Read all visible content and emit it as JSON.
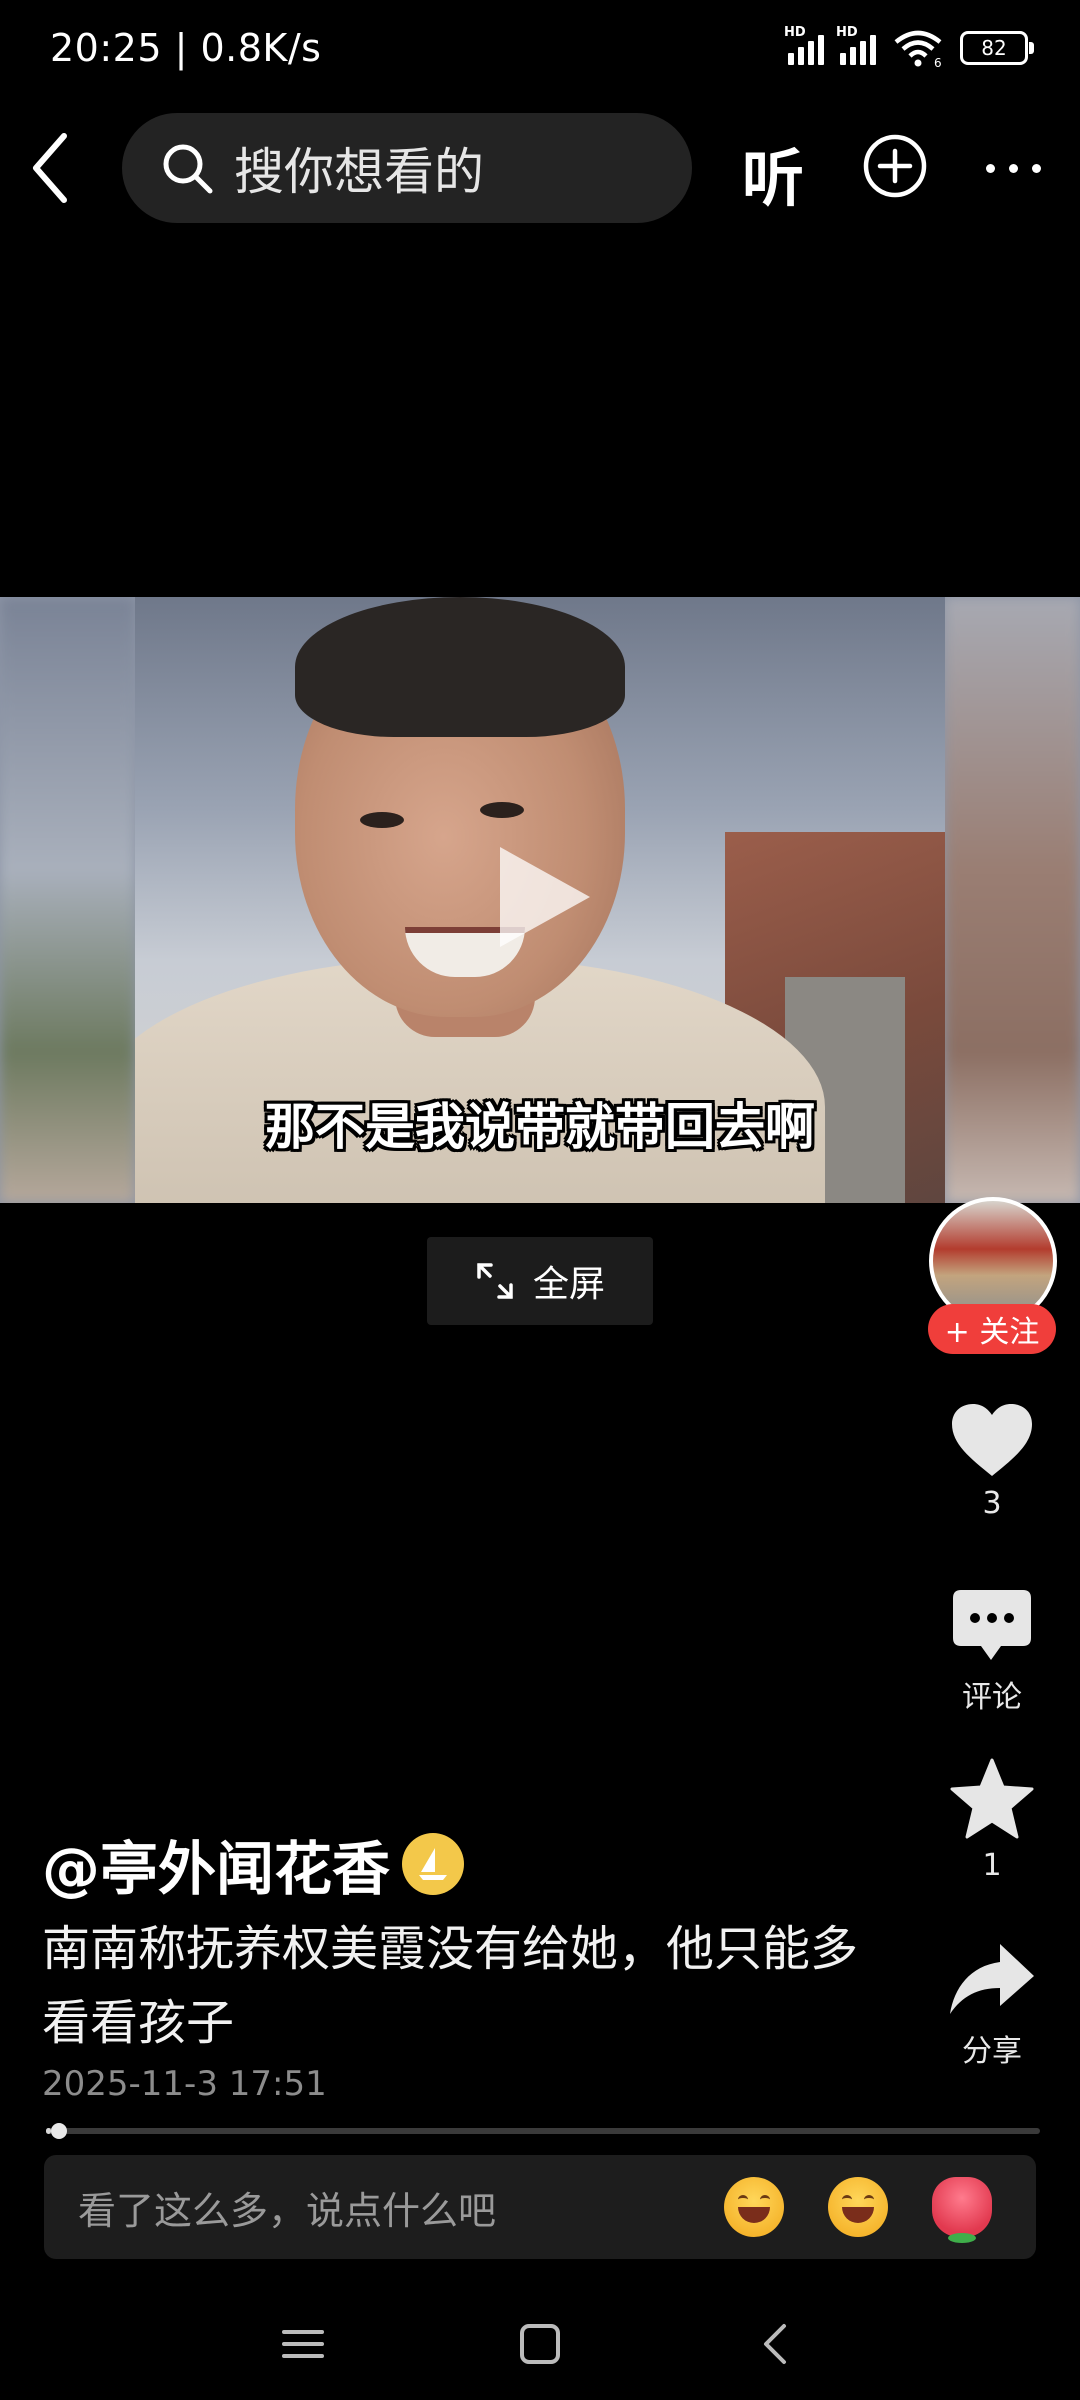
{
  "status_bar": {
    "time_speed": "20:25 | 0.8K/s",
    "hd_label_1": "HD",
    "hd_label_2": "HD",
    "wifi_label": "6",
    "battery": "82"
  },
  "top_nav": {
    "search_placeholder": "搜你想看的",
    "listen_label": "听"
  },
  "video": {
    "subtitle": "那不是我说带就带回去啊"
  },
  "fullscreen": {
    "label": "全屏"
  },
  "side_actions": {
    "follow_label": "+ 关注",
    "like_count": "3",
    "comment_label": "评论",
    "favorite_count": "1",
    "share_label": "分享"
  },
  "post": {
    "author": "@亭外闻花香",
    "description": "南南称抚养权美霞没有给她，他只能多看看孩子",
    "timestamp": "2025-11-3 17:51",
    "progress": 0.005
  },
  "comment_bar": {
    "placeholder": "看了这么多，说点什么吧",
    "emojis": [
      "grin-emoji",
      "laugh-cry-emoji",
      "rose-emoji"
    ]
  },
  "colors": {
    "background": "#000000",
    "follow_red": "#f03e3b",
    "badge_gold": "#f3c84a"
  }
}
